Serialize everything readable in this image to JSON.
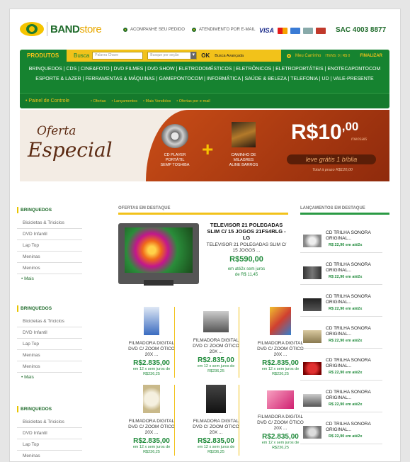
{
  "header": {
    "logo_band": "BAND",
    "logo_store": "store",
    "link_pedido": "ACOMPANHE SEU PEDIDO",
    "link_email": "ATENDIMENTO POR E-MAIL",
    "visa": "VISA",
    "sac": "SAC 4003 8877"
  },
  "nav": {
    "produtos": "PRODUTOS",
    "busca": "Busca",
    "busca_placeholder": "Palavra Chave",
    "secao_placeholder": "Busque por seção",
    "ok": "OK",
    "avancada": "Busca Avançada",
    "carrinho": "Meu Carrinho",
    "itens": "ITENS: 0 | R$ 0",
    "finalizar": "FINALIZAR",
    "categories_row1": [
      "BRINQUEDOS",
      "CDS",
      "CINE&FOTO",
      "DVD FILMES",
      "DVD SHOW",
      "ELETRODOMÉSTICOS",
      "ELETRÔNICOS",
      "ELETROPORTÁTEIS",
      "ENOTECAPONTOCOM"
    ],
    "categories_row2": [
      "ESPORTE & LAZER",
      "FERRAMENTAS & MÁQUINAS",
      "GAMEPONTOCOM",
      "INFORMÁTICA",
      "SAÚDE & BELEZA",
      "TELEFONIA",
      "UD",
      "VALE-PRESENTE"
    ],
    "painel": "Painel de Controle",
    "sublinks": [
      "Ofertas",
      "Lançamentos",
      "Mais Vendidos",
      "Ofertas por e-mail"
    ]
  },
  "banner": {
    "oferta": "Oferta",
    "especial": "Especial",
    "item1": [
      "CD PLAYER",
      "PORTÁTIL",
      "SEMP TOSHIBA"
    ],
    "item2": [
      "CAMINHO DE",
      "MILAGRES",
      "ALINE BARROS"
    ],
    "price": "R$10",
    "cents": ",00",
    "mensais": "mensais",
    "leve": "leve grátis 1 bíblia",
    "prazo": "Total à prazo R$120,00"
  },
  "sidebar": [
    {
      "title": "BRINQUEDOS",
      "items": [
        "Bicicletas & Triciclos",
        "DVD Infantil",
        "Lap Top",
        "Meninas",
        "Meninos"
      ],
      "mais": "Mais"
    },
    {
      "title": "BRINQUEDOS",
      "items": [
        "Bicicletas & Triciclos",
        "DVD Infantil",
        "Lap Top",
        "Meninas",
        "Meninos"
      ],
      "mais": "Mais"
    },
    {
      "title": "BRINQUEDOS",
      "items": [
        "Bicicletas & Triciclos",
        "DVD Infantil",
        "Lap Top",
        "Meninas"
      ]
    }
  ],
  "ofertas": {
    "title": "OFERTAS EM DESTAQUE",
    "featured": {
      "title": "TELEVISOR 21 POLEGADAS SLIM C/ 15 JOGOS 21FS4RLG - LG",
      "desc": "TELEVISOR 21 POLEGADAS SLIM C/ 15 JOGOS ...",
      "price": "R$590,00",
      "parc1": "em até2x sem juros",
      "parc2": "de R$ 11,45"
    },
    "products": [
      {
        "name": "FILMADORA DIGITAL DVD C/ ZOOM ÓTICO 20X ...",
        "price": "R$2.835,00",
        "parc1": "em 12 x sem juros de",
        "parc2": "R$236,25"
      },
      {
        "name": "FILMADORA DIGITAL DVD C/ ZOOM ÓTICO 20X ...",
        "price": "R$2.835,00",
        "parc1": "em 12 x sem juros de",
        "parc2": "R$236,25"
      },
      {
        "name": "FILMADORA DIGITAL DVD C/ ZOOM ÓTICO 20X ...",
        "price": "R$2.835,00",
        "parc1": "em 12 x sem juros de",
        "parc2": "R$236,25"
      },
      {
        "name": "FILMADORA DIGITAL DVD C/ ZOOM ÓTICO 20X ...",
        "price": "R$2.835,00",
        "parc1": "em 12 x sem juros de",
        "parc2": "R$236,25"
      },
      {
        "name": "FILMADORA DIGITAL DVD C/ ZOOM ÓTICO 20X ...",
        "price": "R$2.835,00",
        "parc1": "em 12 x sem juros de",
        "parc2": "R$236,25"
      },
      {
        "name": "FILMADORA DIGITAL DVD C/ ZOOM ÓTICO 20X ...",
        "price": "R$2.835,00",
        "parc1": "em 12 x sem juros de",
        "parc2": "R$236,25"
      }
    ]
  },
  "lancamentos": {
    "title": "LANÇAMENTOS EM DESTAQUE",
    "items": [
      {
        "name": "CD TRILHA SONORA ORIGINAL...",
        "price": "R$ 22,90 em até2x"
      },
      {
        "name": "CD TRILHA SONORA ORIGINAL...",
        "price": "R$ 22,90 em até2x"
      },
      {
        "name": "CD TRILHA SONORA ORIGINAL...",
        "price": "R$ 22,90 em até2x"
      },
      {
        "name": "CD TRILHA SONORA ORIGINAL...",
        "price": "R$ 22,90 em até2x"
      },
      {
        "name": "CD TRILHA SONORA ORIGINAL...",
        "price": "R$ 22,90 em até2x"
      },
      {
        "name": "CD TRILHA SONORA ORIGINAL...",
        "price": "R$ 22,90 em até2x"
      },
      {
        "name": "CD TRILHA SONORA ORIGINAL...",
        "price": "R$ 22,90 em até2x"
      }
    ]
  },
  "colors": {
    "green": "#168330",
    "yellow": "#f2c21a",
    "banner": "#c94d17"
  }
}
